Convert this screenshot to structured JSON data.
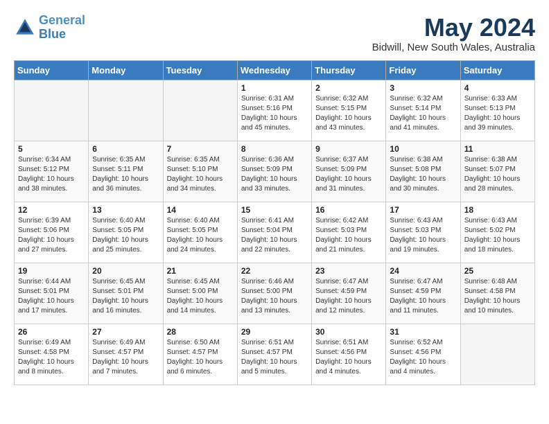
{
  "logo": {
    "line1": "General",
    "line2": "Blue"
  },
  "title": "May 2024",
  "location": "Bidwill, New South Wales, Australia",
  "days_of_week": [
    "Sunday",
    "Monday",
    "Tuesday",
    "Wednesday",
    "Thursday",
    "Friday",
    "Saturday"
  ],
  "weeks": [
    [
      {
        "day": "",
        "info": ""
      },
      {
        "day": "",
        "info": ""
      },
      {
        "day": "",
        "info": ""
      },
      {
        "day": "1",
        "info": "Sunrise: 6:31 AM\nSunset: 5:16 PM\nDaylight: 10 hours\nand 45 minutes."
      },
      {
        "day": "2",
        "info": "Sunrise: 6:32 AM\nSunset: 5:15 PM\nDaylight: 10 hours\nand 43 minutes."
      },
      {
        "day": "3",
        "info": "Sunrise: 6:32 AM\nSunset: 5:14 PM\nDaylight: 10 hours\nand 41 minutes."
      },
      {
        "day": "4",
        "info": "Sunrise: 6:33 AM\nSunset: 5:13 PM\nDaylight: 10 hours\nand 39 minutes."
      }
    ],
    [
      {
        "day": "5",
        "info": "Sunrise: 6:34 AM\nSunset: 5:12 PM\nDaylight: 10 hours\nand 38 minutes."
      },
      {
        "day": "6",
        "info": "Sunrise: 6:35 AM\nSunset: 5:11 PM\nDaylight: 10 hours\nand 36 minutes."
      },
      {
        "day": "7",
        "info": "Sunrise: 6:35 AM\nSunset: 5:10 PM\nDaylight: 10 hours\nand 34 minutes."
      },
      {
        "day": "8",
        "info": "Sunrise: 6:36 AM\nSunset: 5:09 PM\nDaylight: 10 hours\nand 33 minutes."
      },
      {
        "day": "9",
        "info": "Sunrise: 6:37 AM\nSunset: 5:09 PM\nDaylight: 10 hours\nand 31 minutes."
      },
      {
        "day": "10",
        "info": "Sunrise: 6:38 AM\nSunset: 5:08 PM\nDaylight: 10 hours\nand 30 minutes."
      },
      {
        "day": "11",
        "info": "Sunrise: 6:38 AM\nSunset: 5:07 PM\nDaylight: 10 hours\nand 28 minutes."
      }
    ],
    [
      {
        "day": "12",
        "info": "Sunrise: 6:39 AM\nSunset: 5:06 PM\nDaylight: 10 hours\nand 27 minutes."
      },
      {
        "day": "13",
        "info": "Sunrise: 6:40 AM\nSunset: 5:05 PM\nDaylight: 10 hours\nand 25 minutes."
      },
      {
        "day": "14",
        "info": "Sunrise: 6:40 AM\nSunset: 5:05 PM\nDaylight: 10 hours\nand 24 minutes."
      },
      {
        "day": "15",
        "info": "Sunrise: 6:41 AM\nSunset: 5:04 PM\nDaylight: 10 hours\nand 22 minutes."
      },
      {
        "day": "16",
        "info": "Sunrise: 6:42 AM\nSunset: 5:03 PM\nDaylight: 10 hours\nand 21 minutes."
      },
      {
        "day": "17",
        "info": "Sunrise: 6:43 AM\nSunset: 5:03 PM\nDaylight: 10 hours\nand 19 minutes."
      },
      {
        "day": "18",
        "info": "Sunrise: 6:43 AM\nSunset: 5:02 PM\nDaylight: 10 hours\nand 18 minutes."
      }
    ],
    [
      {
        "day": "19",
        "info": "Sunrise: 6:44 AM\nSunset: 5:01 PM\nDaylight: 10 hours\nand 17 minutes."
      },
      {
        "day": "20",
        "info": "Sunrise: 6:45 AM\nSunset: 5:01 PM\nDaylight: 10 hours\nand 16 minutes."
      },
      {
        "day": "21",
        "info": "Sunrise: 6:45 AM\nSunset: 5:00 PM\nDaylight: 10 hours\nand 14 minutes."
      },
      {
        "day": "22",
        "info": "Sunrise: 6:46 AM\nSunset: 5:00 PM\nDaylight: 10 hours\nand 13 minutes."
      },
      {
        "day": "23",
        "info": "Sunrise: 6:47 AM\nSunset: 4:59 PM\nDaylight: 10 hours\nand 12 minutes."
      },
      {
        "day": "24",
        "info": "Sunrise: 6:47 AM\nSunset: 4:59 PM\nDaylight: 10 hours\nand 11 minutes."
      },
      {
        "day": "25",
        "info": "Sunrise: 6:48 AM\nSunset: 4:58 PM\nDaylight: 10 hours\nand 10 minutes."
      }
    ],
    [
      {
        "day": "26",
        "info": "Sunrise: 6:49 AM\nSunset: 4:58 PM\nDaylight: 10 hours\nand 8 minutes."
      },
      {
        "day": "27",
        "info": "Sunrise: 6:49 AM\nSunset: 4:57 PM\nDaylight: 10 hours\nand 7 minutes."
      },
      {
        "day": "28",
        "info": "Sunrise: 6:50 AM\nSunset: 4:57 PM\nDaylight: 10 hours\nand 6 minutes."
      },
      {
        "day": "29",
        "info": "Sunrise: 6:51 AM\nSunset: 4:57 PM\nDaylight: 10 hours\nand 5 minutes."
      },
      {
        "day": "30",
        "info": "Sunrise: 6:51 AM\nSunset: 4:56 PM\nDaylight: 10 hours\nand 4 minutes."
      },
      {
        "day": "31",
        "info": "Sunrise: 6:52 AM\nSunset: 4:56 PM\nDaylight: 10 hours\nand 4 minutes."
      },
      {
        "day": "",
        "info": ""
      }
    ]
  ]
}
